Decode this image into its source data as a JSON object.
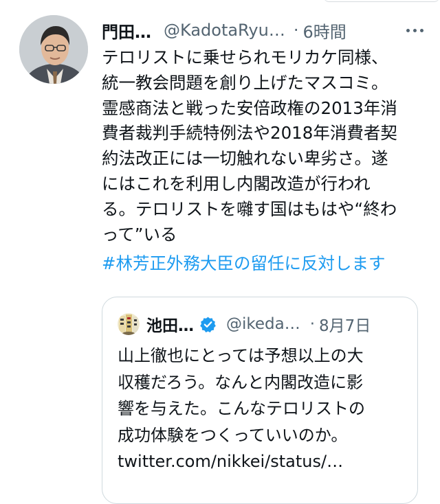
{
  "tweet": {
    "author_name": "門田…",
    "author_handle": "@KadotaRyu…",
    "separator": "·",
    "time": "6時間",
    "text": "テロリストに乗せられモリカケ同様、\n統一教会問題を創り上げたマスコミ。\n霊感商法と戦った安倍政権の2013年消\n費者裁判手続特例法や2018年消費者契\n約法改正には一切触れない卑劣さ。遂\nにはこれを利用し内閣改造が行われ\nる。テロリストを囃す国はもはや“終わ\nって”いる",
    "hashtag": "#林芳正外務大臣の留任に反対します",
    "more_icon": "more-horizontal-icon"
  },
  "quoted": {
    "author_name": "池田…",
    "author_handle": "@ikeda…",
    "separator": "·",
    "time": "8月7日",
    "text": "山上徹也にとっては予想以上の大\n収穫だろう。なんと内閣改造に影\n響を与えた。こんなテロリストの\n成功体験をつくっていいのか。",
    "link": "twitter.com/nikkei/status/…",
    "verified_icon": "verified-badge-icon"
  },
  "colors": {
    "text": "#0f1419",
    "secondary": "#536471",
    "link": "#1d9bf0",
    "border": "#cfd9de"
  }
}
